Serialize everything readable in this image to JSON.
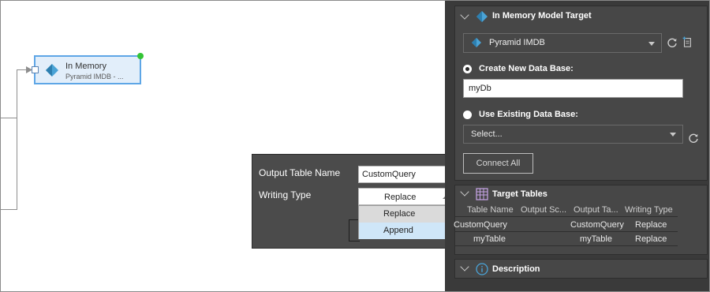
{
  "canvas": {
    "node": {
      "title": "In Memory",
      "subtitle": "Pyramid IMDB - ..."
    }
  },
  "popup": {
    "output_table_label": "Output Table Name",
    "output_table_value": "CustomQuery",
    "writing_type_label": "Writing Type",
    "writing_type_value": "Replace",
    "options": [
      "Replace",
      "Append"
    ]
  },
  "panel": {
    "target_section": {
      "title": "In Memory Model Target",
      "source_value": "Pyramid IMDB",
      "create_new_label": "Create New Data Base:",
      "create_new_value": "myDb",
      "use_existing_label": "Use Existing Data Base:",
      "use_existing_placeholder": "Select...",
      "connect_all_label": "Connect All"
    },
    "tables_section": {
      "title": "Target Tables",
      "columns": [
        "Table Name",
        "Output Sc...",
        "Output Ta...",
        "Writing Type"
      ],
      "rows": [
        [
          "CustomQuery",
          "",
          "CustomQuery",
          "Replace"
        ],
        [
          "myTable",
          "",
          "myTable",
          "Replace"
        ]
      ]
    },
    "description_section": {
      "title": "Description"
    }
  },
  "colors": {
    "panel_bg": "#3a3a3a",
    "section_bg": "#474747",
    "node_border": "#5ea6e6",
    "node_handle": "#34c435",
    "accent_icon": "#4aa3d6"
  }
}
